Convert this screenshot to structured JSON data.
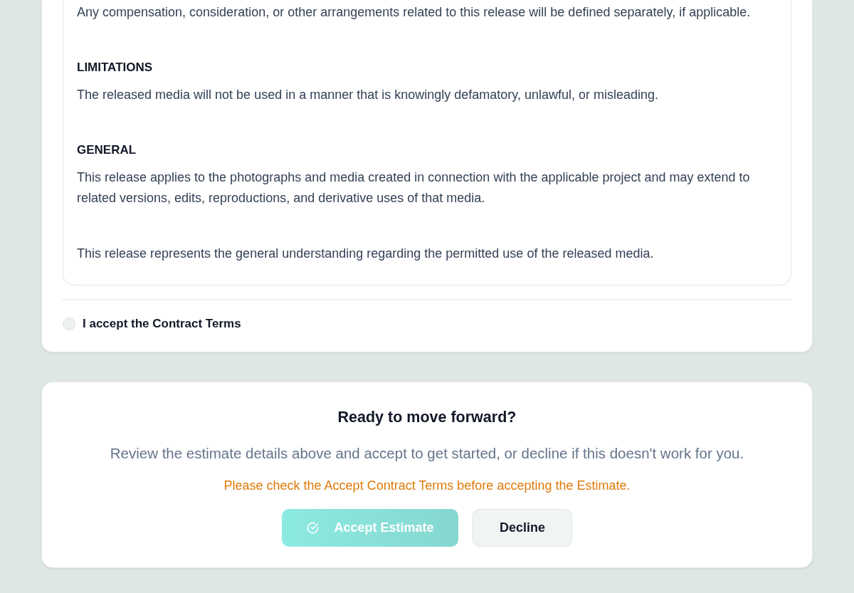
{
  "contract": {
    "terms_sections": [
      {
        "body": "Any compensation, consideration, or other arrangements related to this release will be defined separately, if applicable."
      },
      {
        "heading": "LIMITATIONS",
        "body": "The released media will not be used in a manner that is knowingly defamatory, unlawful, or misleading."
      },
      {
        "heading": "GENERAL",
        "body": "This release applies to the photographs and media created in connection with the applicable project and may extend to related versions, edits, reproductions, and derivative uses of that media."
      },
      {
        "body": "This release represents the general understanding regarding the permitted use of the released media."
      }
    ],
    "acceptance": {
      "label": "I accept the Contract Terms",
      "checked": false
    }
  },
  "call_to_action": {
    "title": "Ready to move forward?",
    "description": "Review the estimate details above and accept to get started, or decline if this doesn't work for you.",
    "warning": "Please check the Accept Contract Terms before accepting the Estimate.",
    "actions": [
      {
        "kind": "primary",
        "label": "Accept Estimate",
        "disabled": true
      },
      {
        "kind": "secondary",
        "label": "Decline",
        "disabled": false
      }
    ]
  }
}
